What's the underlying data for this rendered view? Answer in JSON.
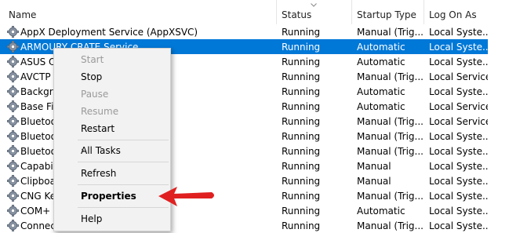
{
  "header": {
    "name": "Name",
    "status": "Status",
    "startup_type": "Startup Type",
    "log_on_as": "Log On As"
  },
  "rows": [
    {
      "name": "AppX Deployment Service (AppXSVC)",
      "status": "Running",
      "type": "Manual (Trig...",
      "logon": "Local Syste..."
    },
    {
      "name": "ARMOURY CRATE Service",
      "status": "Running",
      "type": "Automatic",
      "logon": "Local Syste..."
    },
    {
      "name": "ASUS O",
      "status": "Running",
      "type": "Automatic",
      "logon": "Local Syste..."
    },
    {
      "name": "AVCTP s",
      "status": "Running",
      "type": "Manual (Trig...",
      "logon": "Local Service"
    },
    {
      "name": "Backgro                                  vice",
      "status": "Running",
      "type": "Automatic",
      "logon": "Local Syste..."
    },
    {
      "name": "Base Filt",
      "status": "Running",
      "type": "Automatic",
      "logon": "Local Service"
    },
    {
      "name": "Bluetoo",
      "status": "Running",
      "type": "Manual (Trig...",
      "logon": "Local Service"
    },
    {
      "name": "Bluetoo",
      "status": "Running",
      "type": "Manual (Trig...",
      "logon": "Local Syste..."
    },
    {
      "name": "Bluetoo                                     de",
      "status": "Running",
      "type": "Manual (Trig...",
      "logon": "Local Syste..."
    },
    {
      "name": "Capabil",
      "status": "Running",
      "type": "Manual",
      "logon": "Local Syste..."
    },
    {
      "name": "Clipboa",
      "status": "Running",
      "type": "Manual",
      "logon": "Local Syste..."
    },
    {
      "name": "CNG Ke",
      "status": "Running",
      "type": "Manual (Trig...",
      "logon": "Local Syste..."
    },
    {
      "name": "COM+ I",
      "status": "Running",
      "type": "Automatic",
      "logon": "Local Syste..."
    },
    {
      "name": "Connec",
      "status": "Running",
      "type": "Manual (Trig...",
      "logon": "Local Syste..."
    }
  ],
  "menu": {
    "start": "Start",
    "stop": "Stop",
    "pause": "Pause",
    "resume": "Resume",
    "restart": "Restart",
    "all_tasks": "All Tasks",
    "refresh": "Refresh",
    "properties": "Properties",
    "help": "Help"
  },
  "colors": {
    "selection": "#0078d7",
    "annotation_arrow": "#e02020"
  },
  "icons": {
    "service": "gear-icon",
    "sort": "sort-down-icon",
    "submenu": "chevron-right-icon",
    "annotation": "red-arrow-icon"
  }
}
